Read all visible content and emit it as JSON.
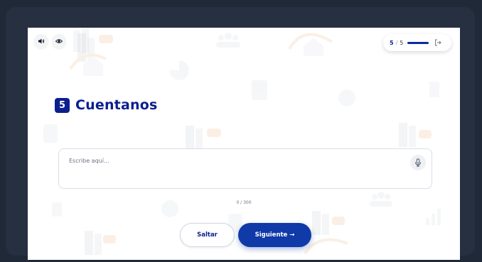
{
  "header": {
    "sound_icon": "speaker-icon",
    "eye_icon": "eye-icon",
    "progress": {
      "current": "5",
      "separator": "/",
      "total": "5",
      "fraction": 1.0,
      "exit_icon": "exit-icon"
    }
  },
  "question": {
    "number": "5",
    "title": "Cuentanos"
  },
  "answer": {
    "placeholder": "Escribe aquí...",
    "mic_icon": "microphone-icon",
    "counter": "0 / 300"
  },
  "actions": {
    "skip_label": "Saltar",
    "next_label": "Siguiente →"
  },
  "colors": {
    "primary": "#0b1f8f",
    "button": "#0f3aa8",
    "frame": "#1f2937"
  }
}
